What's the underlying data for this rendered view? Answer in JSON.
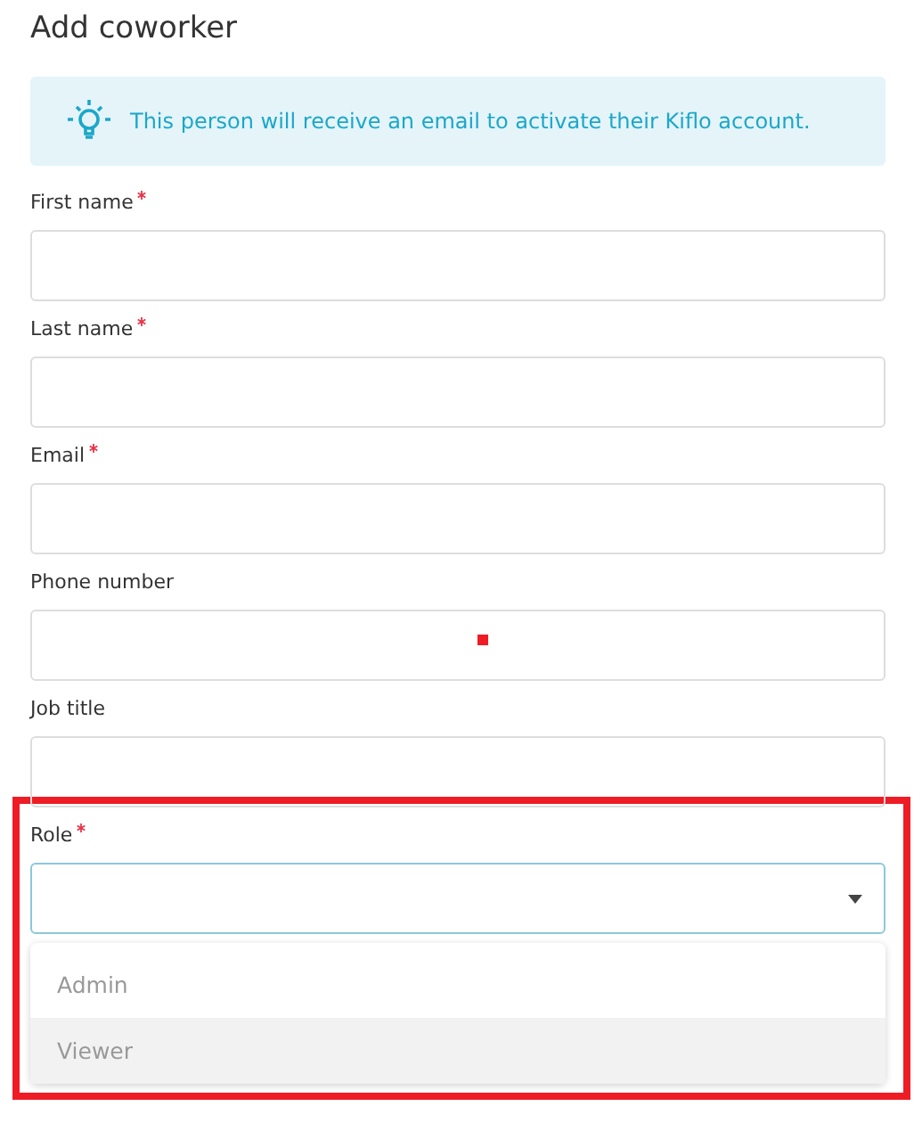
{
  "title": "Add coworker",
  "notice": {
    "text": "This person will receive an email to activate their Kiflo account."
  },
  "fields": [
    {
      "kind": "text",
      "label": "First name",
      "required": true,
      "marker": false
    },
    {
      "kind": "text",
      "label": "Last name",
      "required": true,
      "marker": false
    },
    {
      "kind": "text",
      "label": "Email",
      "required": true,
      "marker": false
    },
    {
      "kind": "text",
      "label": "Phone number",
      "required": false,
      "marker": true
    },
    {
      "kind": "text",
      "label": "Job title",
      "required": false,
      "marker": false
    },
    {
      "kind": "select",
      "label": "Role",
      "required": true,
      "highlighted": true,
      "expanded": true,
      "options": [
        {
          "label": "Admin",
          "selected": false
        },
        {
          "label": "Viewer",
          "selected": true
        }
      ]
    }
  ]
}
